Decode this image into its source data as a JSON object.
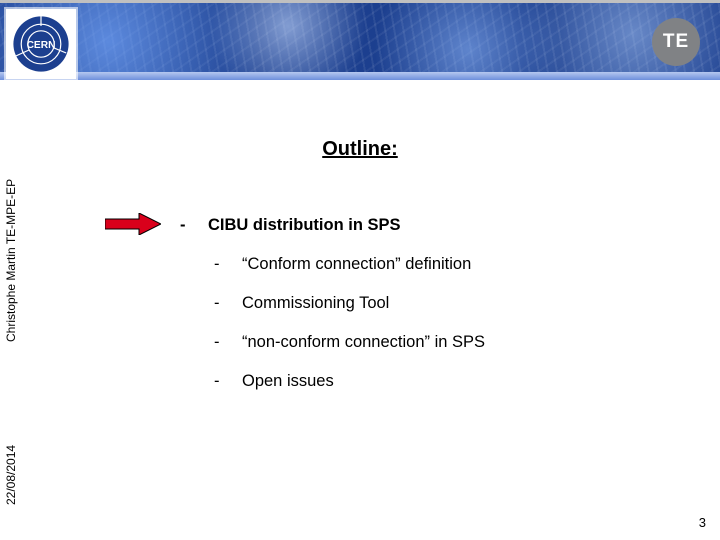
{
  "header": {
    "logo_label": "CERN",
    "badge_label": "TE"
  },
  "side": {
    "author": "Christophe Martin TE-MPE-EP",
    "date": "22/08/2014"
  },
  "title": "Outline:",
  "outline": {
    "current": {
      "dash": "-",
      "text": "CIBU distribution in SPS"
    },
    "items": [
      {
        "dash": "-",
        "text": "“Conform connection” definition"
      },
      {
        "dash": "-",
        "text": "Commissioning Tool"
      },
      {
        "dash": "-",
        "text": "“non-conform connection” in SPS"
      },
      {
        "dash": "-",
        "text": "Open issues"
      }
    ]
  },
  "page_number": "3",
  "colors": {
    "header_bg": "#1c3f8f",
    "badge_bg": "#808285",
    "arrow_fill": "#d9001b",
    "arrow_stroke": "#000000"
  }
}
